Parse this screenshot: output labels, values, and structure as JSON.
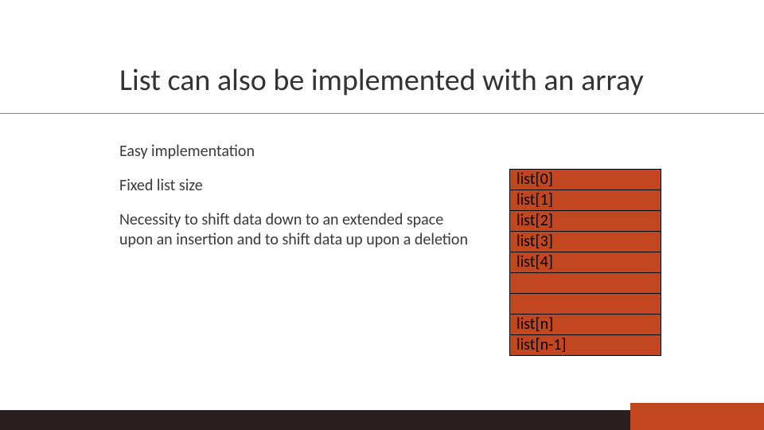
{
  "title": "List can also be implemented with an array",
  "bullets": [
    "Easy implementation",
    "Fixed list size",
    "Necessity to shift data down to an extended space upon an insertion and to shift data up upon a deletion"
  ],
  "array_cells": [
    "list[0]",
    "list[1]",
    "list[2]",
    "list[3]",
    "list[4]",
    "",
    "",
    "list[n]",
    "list[n-1]"
  ],
  "colors": {
    "accent": "#c24720",
    "footer_dark": "#2a2020"
  }
}
